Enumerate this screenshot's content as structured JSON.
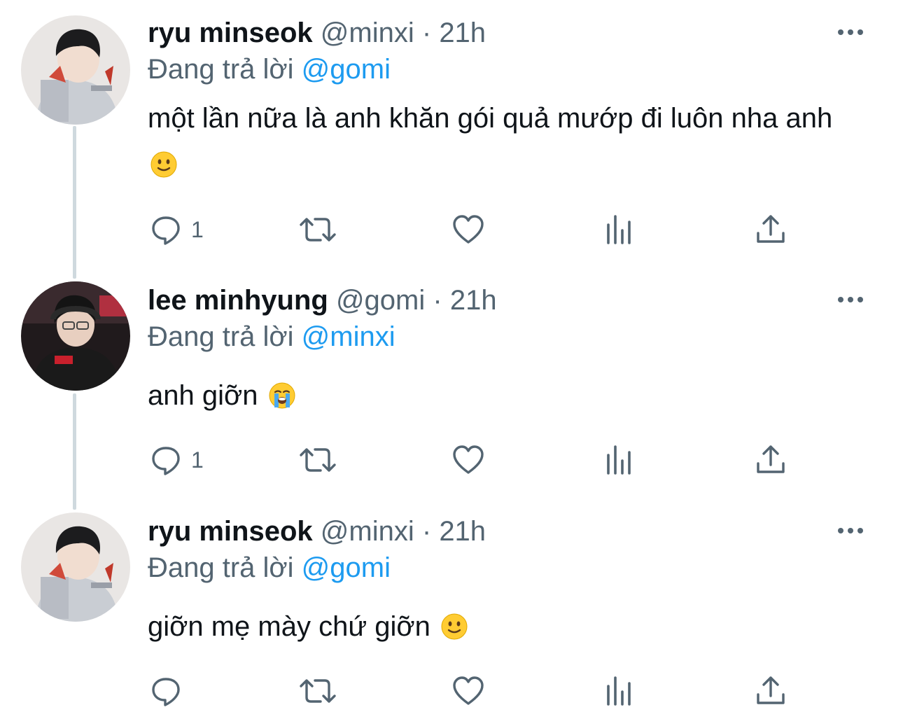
{
  "tweets": [
    {
      "name": "ryu minseok",
      "handle": "@minxi",
      "sep": "·",
      "time": "21h",
      "reply_prefix": "Đang trả lời",
      "reply_to": "@gomi",
      "text": "một lần nữa là anh khăn gói quả mướp đi luôn nha anh",
      "emoji": "slightly-smiling-face",
      "reply_count": "1"
    },
    {
      "name": "lee minhyung",
      "handle": "@gomi",
      "sep": "·",
      "time": "21h",
      "reply_prefix": "Đang trả lời",
      "reply_to": "@minxi",
      "text": "anh giỡn",
      "emoji": "loudly-crying-face",
      "reply_count": "1"
    },
    {
      "name": "ryu minseok",
      "handle": "@minxi",
      "sep": "·",
      "time": "21h",
      "reply_prefix": "Đang trả lời",
      "reply_to": "@gomi",
      "text": "giỡn mẹ mày chứ giỡn",
      "emoji": "slightly-smiling-face",
      "reply_count": ""
    }
  ],
  "colors": {
    "text": "#0f1419",
    "muted": "#536471",
    "link": "#1d9bf0",
    "thread_line": "#cfd9de"
  }
}
